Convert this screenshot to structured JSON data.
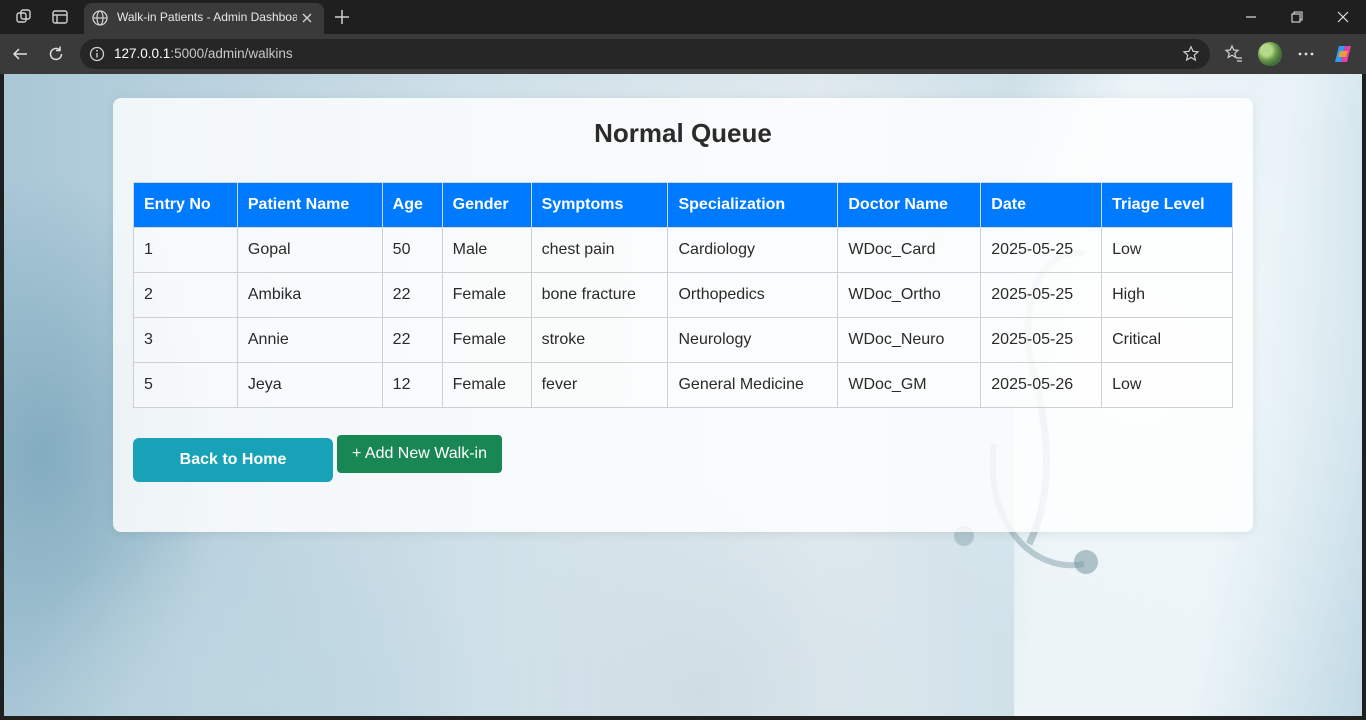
{
  "browser": {
    "tab_title": "Walk-in Patients - Admin Dashboard",
    "url_host": "127.0.0.1",
    "url_rest": ":5000/admin/walkins",
    "icons": [
      "workspaces-icon",
      "vertical-tabs-icon",
      "globe-icon",
      "close-icon",
      "plus-icon",
      "minimize-icon",
      "restore-icon",
      "window-close-icon",
      "back-icon",
      "refresh-icon",
      "site-info-icon",
      "star-icon",
      "favorites-icon",
      "profile-avatar",
      "more-icon",
      "copilot-icon"
    ]
  },
  "page": {
    "title": "Normal Queue",
    "table": {
      "headers": [
        "Entry No",
        "Patient Name",
        "Age",
        "Gender",
        "Symptoms",
        "Specialization",
        "Doctor Name",
        "Date",
        "Triage Level"
      ],
      "rows": [
        [
          "1",
          "Gopal",
          "50",
          "Male",
          "chest pain",
          "Cardiology",
          "WDoc_Card",
          "2025-05-25",
          "Low"
        ],
        [
          "2",
          "Ambika",
          "22",
          "Female",
          "bone fracture",
          "Orthopedics",
          "WDoc_Ortho",
          "2025-05-25",
          "High"
        ],
        [
          "3",
          "Annie",
          "22",
          "Female",
          "stroke",
          "Neurology",
          "WDoc_Neuro",
          "2025-05-25",
          "Critical"
        ],
        [
          "5",
          "Jeya",
          "12",
          "Female",
          "fever",
          "General Medicine",
          "WDoc_GM",
          "2025-05-26",
          "Low"
        ]
      ]
    },
    "buttons": {
      "back_home": "Back to Home",
      "add_walkin": "+ Add New Walk-in"
    }
  },
  "colors": {
    "header_blue": "#007bff",
    "back_button_teal": "#17a2b8",
    "add_button_green": "#198754"
  }
}
